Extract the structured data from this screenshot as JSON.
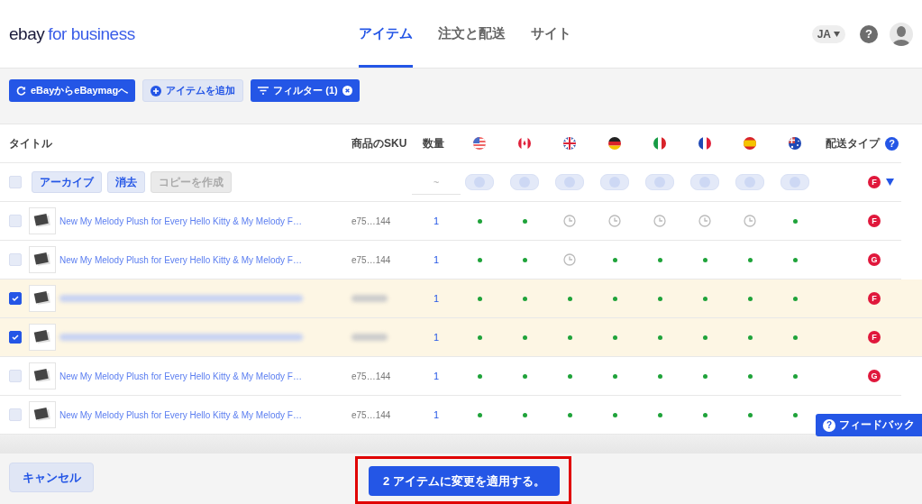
{
  "header": {
    "logo": {
      "brand": "ebay",
      "suffix": "for business"
    },
    "tabs": [
      {
        "label": "アイテム",
        "selected": true
      },
      {
        "label": "注文と配送",
        "selected": false
      },
      {
        "label": "サイト",
        "selected": false
      }
    ],
    "language": "JA",
    "help_icon": "?"
  },
  "toolbar": {
    "buttons": [
      {
        "kind": "sync",
        "label": "eBayからeBaymagへ"
      },
      {
        "kind": "add",
        "label": "アイテムを追加"
      },
      {
        "kind": "filter",
        "label": "フィルター (1)"
      }
    ]
  },
  "table": {
    "columns": {
      "title": "タイトル",
      "sku": "商品のSKU",
      "quantity": "数量",
      "markets": [
        {
          "kind": "us"
        },
        {
          "kind": "ca"
        },
        {
          "kind": "gb"
        },
        {
          "kind": "de"
        },
        {
          "kind": "it"
        },
        {
          "kind": "fr"
        },
        {
          "kind": "es"
        },
        {
          "kind": "au"
        }
      ],
      "shipping": "配送タイプ",
      "shipping_help": "?"
    },
    "bulk_row": {
      "checked": false,
      "toggles": [
        {
          "on": false
        },
        {
          "on": false
        },
        {
          "on": false
        },
        {
          "on": false
        },
        {
          "on": false
        },
        {
          "on": false
        },
        {
          "on": false
        },
        {
          "on": false
        }
      ],
      "actions": [
        {
          "label": "アーカイブ",
          "disabled": false
        },
        {
          "label": "消去",
          "disabled": false
        },
        {
          "label": "コピーを作成",
          "disabled": true
        }
      ],
      "quantity_filter": "~",
      "shipping_badge": "F"
    },
    "rows": [
      {
        "checked": false,
        "redacted": false,
        "title": "New My Melody Plush for Every Hello Kitty & My Melody F…",
        "sku": "e75…144",
        "quantity": "1",
        "markets": [
          {
            "listed": true
          },
          {
            "listed": true
          },
          {
            "listed": false
          },
          {
            "listed": false
          },
          {
            "listed": false
          },
          {
            "listed": false
          },
          {
            "listed": false
          },
          {
            "listed": true
          }
        ],
        "shipping": "F"
      },
      {
        "checked": false,
        "redacted": false,
        "title": "New My Melody Plush for Every Hello Kitty & My Melody F…",
        "sku": "e75…144",
        "quantity": "1",
        "markets": [
          {
            "listed": true
          },
          {
            "listed": true
          },
          {
            "listed": false
          },
          {
            "listed": true
          },
          {
            "listed": true
          },
          {
            "listed": true
          },
          {
            "listed": true
          },
          {
            "listed": true
          }
        ],
        "shipping": "G"
      },
      {
        "checked": true,
        "redacted": true,
        "quantity": "1",
        "markets": [
          {
            "listed": true
          },
          {
            "listed": true
          },
          {
            "listed": true
          },
          {
            "listed": true
          },
          {
            "listed": true
          },
          {
            "listed": true
          },
          {
            "listed": true
          },
          {
            "listed": true
          }
        ],
        "shipping": "F"
      },
      {
        "checked": true,
        "redacted": true,
        "quantity": "1",
        "markets": [
          {
            "listed": true
          },
          {
            "listed": true
          },
          {
            "listed": true
          },
          {
            "listed": true
          },
          {
            "listed": true
          },
          {
            "listed": true
          },
          {
            "listed": true
          },
          {
            "listed": true
          }
        ],
        "shipping": "F"
      },
      {
        "checked": false,
        "redacted": false,
        "title": "New My Melody Plush for Every Hello Kitty & My Melody F…",
        "sku": "e75…144",
        "quantity": "1",
        "markets": [
          {
            "listed": true
          },
          {
            "listed": true
          },
          {
            "listed": true
          },
          {
            "listed": true
          },
          {
            "listed": true
          },
          {
            "listed": true
          },
          {
            "listed": true
          },
          {
            "listed": true
          }
        ],
        "shipping": "G"
      },
      {
        "checked": false,
        "redacted": false,
        "title": "New My Melody Plush for Every Hello Kitty & My Melody F…",
        "sku": "e75…144",
        "quantity": "1",
        "markets": [
          {
            "listed": true
          },
          {
            "listed": true
          },
          {
            "listed": true
          },
          {
            "listed": true
          },
          {
            "listed": true
          },
          {
            "listed": true
          },
          {
            "listed": true
          },
          {
            "listed": true
          }
        ]
      }
    ]
  },
  "feedback": {
    "icon": "?",
    "label": "フィードバック"
  },
  "footer": {
    "cancel": "キャンセル",
    "apply": "2 アイテムに変更を適用する。",
    "apply_highlighted": true
  }
}
